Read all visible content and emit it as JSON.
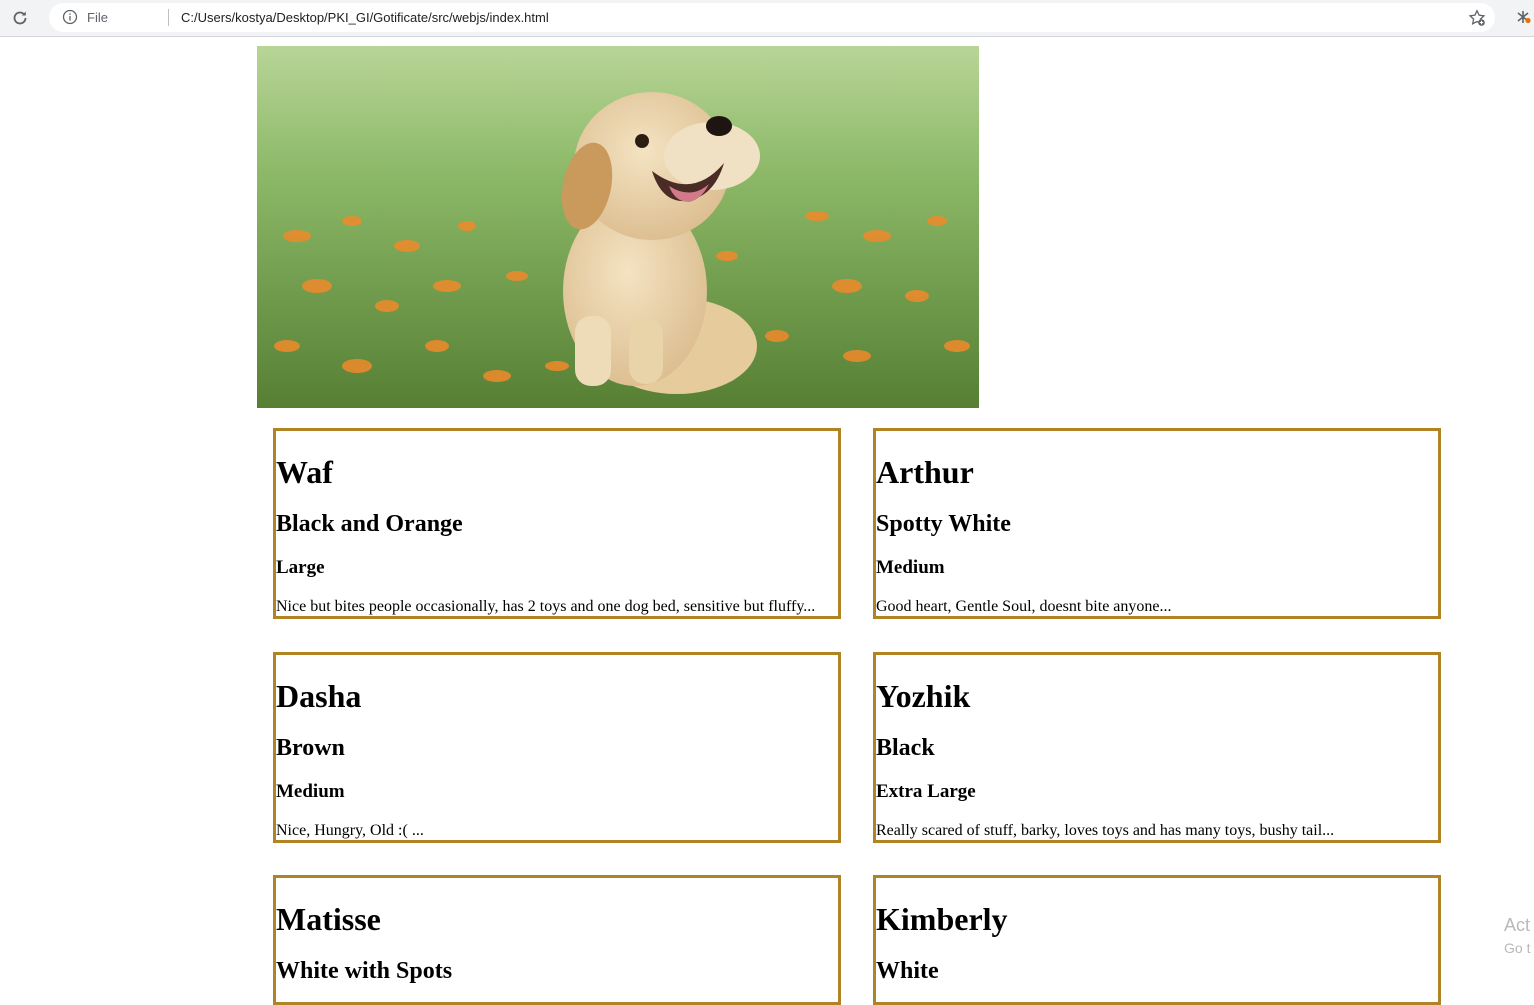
{
  "browser": {
    "scheme_label": "File",
    "url": "C:/Users/kostya/Desktop/PKI_GI/Gotificate/src/webjs/index.html"
  },
  "hero": {
    "alt": "Golden retriever puppy sitting in a field of orange flowers"
  },
  "dogs": [
    {
      "name": "Waf",
      "color": "Black and Orange",
      "size": "Large",
      "description": "Nice but bites people occasionally, has 2 toys and one dog bed, sensitive but fluffy..."
    },
    {
      "name": "Arthur",
      "color": "Spotty White",
      "size": "Medium",
      "description": "Good heart, Gentle Soul, doesnt bite anyone..."
    },
    {
      "name": "Dasha",
      "color": "Brown",
      "size": "Medium",
      "description": "Nice, Hungry, Old :( ..."
    },
    {
      "name": "Yozhik",
      "color": "Black",
      "size": "Extra Large",
      "description": "Really scared of stuff, barky, loves toys and has many toys, bushy tail..."
    },
    {
      "name": "Matisse",
      "color": "White with Spots",
      "size": "",
      "description": ""
    },
    {
      "name": "Kimberly",
      "color": "White",
      "size": "",
      "description": ""
    }
  ],
  "watermark": {
    "line1": "Act",
    "line2": "Go t"
  },
  "theme": {
    "card_border": "#b08424"
  }
}
